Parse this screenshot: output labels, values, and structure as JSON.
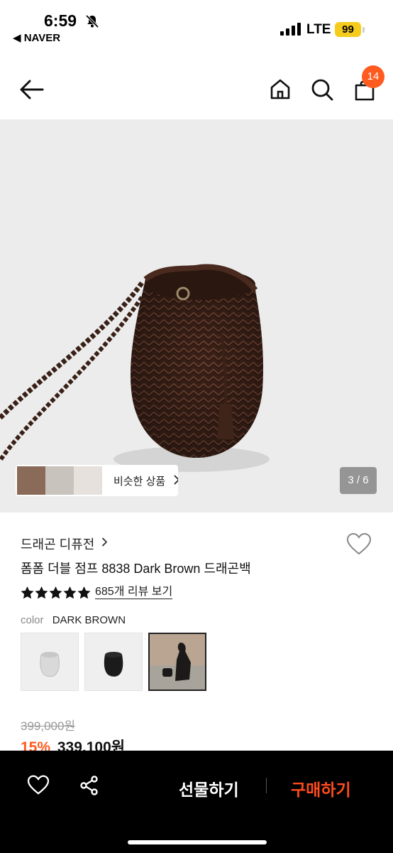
{
  "status_bar": {
    "time": "6:59",
    "back_app": "◀ NAVER",
    "network": "LTE",
    "battery": "99"
  },
  "header": {
    "cart_count": "14"
  },
  "gallery": {
    "similar_label": "비슷한 상품",
    "pager": "3 / 6"
  },
  "product": {
    "brand": "드래곤 디퓨전",
    "name": "폼폼 더블 점프 8838 Dark Brown 드래곤백",
    "rating_stars": 5,
    "review_link": "685개 리뷰 보기",
    "color_key": "color",
    "color_value": "DARK BROWN",
    "original_price": "399,000원",
    "discount": "15%",
    "price": "339,100원"
  },
  "bottom_bar": {
    "gift_label": "선물하기",
    "buy_label": "구매하기"
  },
  "colors": {
    "accent": "#ff5a1f",
    "buy": "#ff4b1f",
    "battery": "#f5cc1c"
  }
}
